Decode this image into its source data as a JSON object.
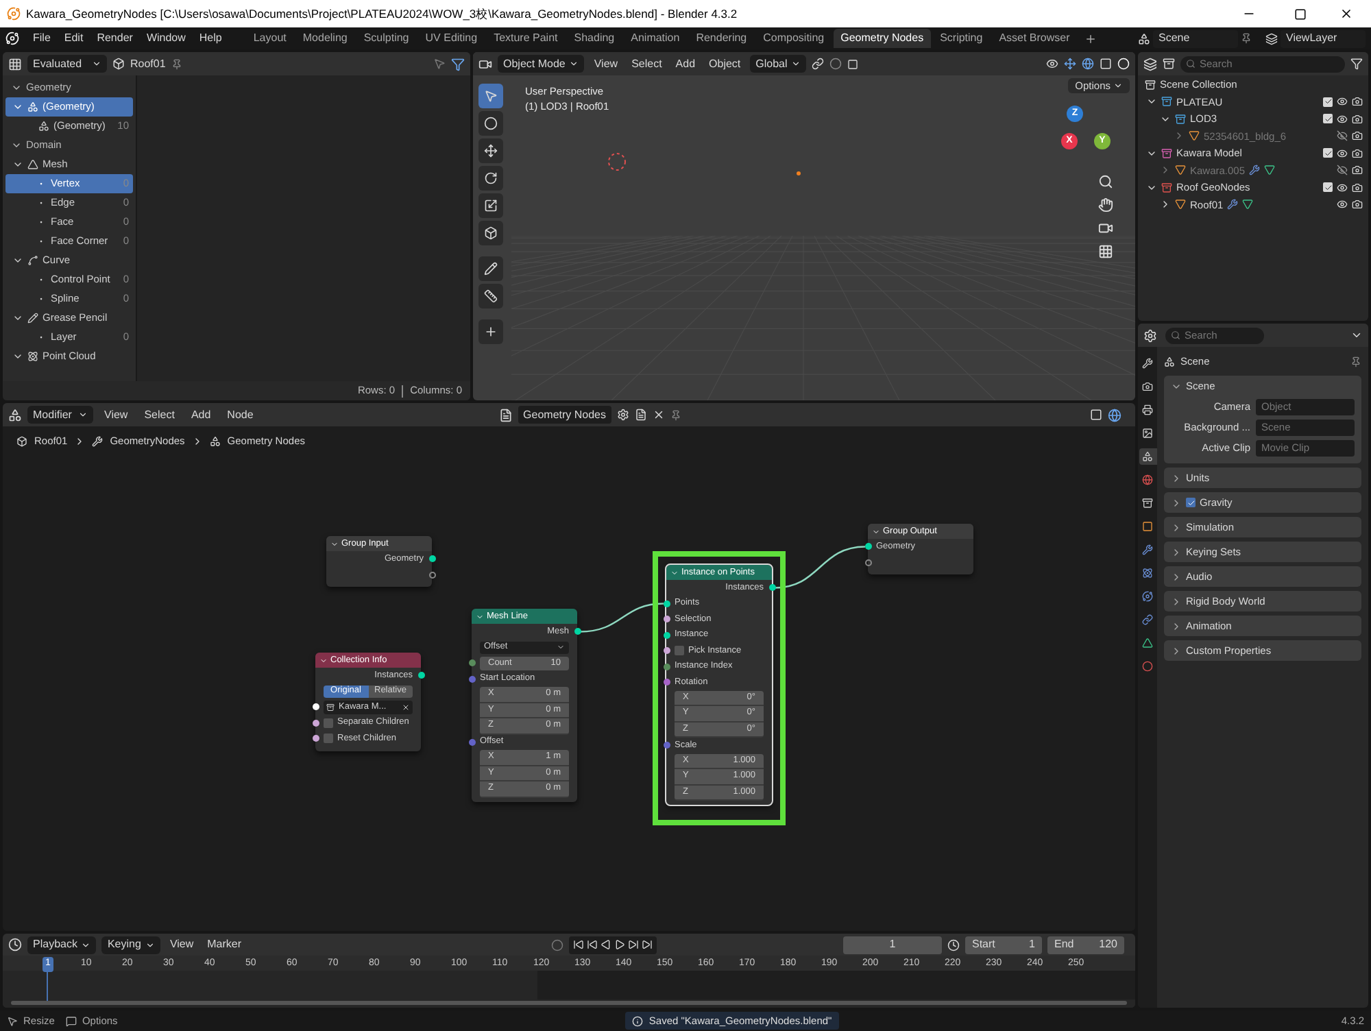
{
  "window": {
    "title": "Kawara_GeometryNodes [C:\\Users\\osawa\\Documents\\Project\\PLATEAU2024\\WOW_3校\\Kawara_GeometryNodes.blend] - Blender 4.3.2"
  },
  "menu": [
    "File",
    "Edit",
    "Render",
    "Window",
    "Help"
  ],
  "workspaces": [
    {
      "label": "Layout",
      "selected": false
    },
    {
      "label": "Modeling",
      "selected": false
    },
    {
      "label": "Sculpting",
      "selected": false
    },
    {
      "label": "UV Editing",
      "selected": false
    },
    {
      "label": "Texture Paint",
      "selected": false
    },
    {
      "label": "Shading",
      "selected": false
    },
    {
      "label": "Animation",
      "selected": false
    },
    {
      "label": "Rendering",
      "selected": false
    },
    {
      "label": "Compositing",
      "selected": false
    },
    {
      "label": "Geometry Nodes",
      "selected": true
    },
    {
      "label": "Scripting",
      "selected": false
    },
    {
      "label": "Asset Browser",
      "selected": false
    }
  ],
  "scene": "Scene",
  "view_layer": "ViewLayer",
  "spreadsheet": {
    "mode": "Evaluated",
    "object": "Roof01",
    "geometry_label": "Geometry",
    "geometry": [
      {
        "label": "(Geometry)",
        "selected": true,
        "expanded": true,
        "children": [
          {
            "label": "(Geometry)",
            "count": "10",
            "selected": false
          }
        ]
      }
    ],
    "domain_label": "Domain",
    "domains": [
      {
        "label": "Mesh",
        "expanded": true,
        "children": [
          {
            "label": "Vertex",
            "count": "0",
            "selected": true
          },
          {
            "label": "Edge",
            "count": "0",
            "selected": false
          },
          {
            "label": "Face",
            "count": "0",
            "selected": false
          },
          {
            "label": "Face Corner",
            "count": "0",
            "selected": false
          }
        ]
      },
      {
        "label": "Curve",
        "expanded": true,
        "children": [
          {
            "label": "Control Point",
            "count": "0",
            "selected": false
          },
          {
            "label": "Spline",
            "count": "0",
            "selected": false
          }
        ]
      },
      {
        "label": "Grease Pencil",
        "expanded": true,
        "children": [
          {
            "label": "Layer",
            "count": "0",
            "selected": false
          }
        ]
      },
      {
        "label": "Point Cloud",
        "expanded": true
      }
    ],
    "rows": "Rows: 0",
    "columns": "Columns: 0"
  },
  "viewport": {
    "mode": "Object Mode",
    "menus": [
      "View",
      "Select",
      "Add",
      "Object"
    ],
    "orientation": "Global",
    "options": "Options",
    "view_name": "User Perspective",
    "view_info": "(1) LOD3 | Roof01",
    "gizmo_axes": [
      "Z",
      "X",
      "Y"
    ],
    "tools": [
      {
        "selected": true
      },
      {
        "selected": false
      },
      {
        "selected": false
      },
      {
        "selected": false
      },
      {
        "selected": false
      },
      {
        "selected": false
      },
      {
        "selected": false
      },
      {
        "selected": false
      },
      {
        "selected": false
      }
    ]
  },
  "outliner": {
    "search_placeholder": "Search",
    "root": "Scene Collection",
    "items": [
      {
        "kind": "collection",
        "label": "PLATEAU",
        "color": "#4aa3df",
        "expanded": true,
        "enabled": true,
        "visible": true,
        "children": [
          {
            "kind": "collection",
            "label": "LOD3",
            "color": "#4aa3df",
            "expanded": true,
            "enabled": true,
            "visible": true,
            "children": [
              {
                "kind": "object",
                "label": "52354601_bldg_6",
                "expanded": false,
                "visible": false,
                "modifiers": false
              }
            ]
          }
        ]
      },
      {
        "kind": "collection",
        "label": "Kawara Model",
        "color": "#d65fb0",
        "expanded": true,
        "enabled": true,
        "visible": true,
        "children": [
          {
            "kind": "object",
            "label": "Kawara.005",
            "expanded": false,
            "visible": false,
            "modifiers": true
          }
        ]
      },
      {
        "kind": "collection",
        "label": "Roof GeoNodes",
        "color": "#e0524e",
        "expanded": true,
        "enabled": true,
        "visible": true,
        "children": [
          {
            "kind": "object",
            "label": "Roof01",
            "expanded": false,
            "visible": true,
            "modifiers": true
          }
        ]
      }
    ]
  },
  "properties": {
    "search_placeholder": "Search",
    "title": "Scene",
    "tabs": [
      {
        "selected": false
      },
      {
        "selected": false
      },
      {
        "selected": false
      },
      {
        "selected": false
      },
      {
        "selected": true
      },
      {
        "selected": false
      },
      {
        "selected": false
      },
      {
        "selected": false
      },
      {
        "selected": false
      },
      {
        "selected": false
      },
      {
        "selected": false
      },
      {
        "selected": false
      },
      {
        "selected": false
      },
      {
        "selected": false
      }
    ],
    "panel": {
      "title": "Scene",
      "expanded": true,
      "fields": [
        {
          "label": "Camera",
          "placeholder": "Object"
        },
        {
          "label": "Background ...",
          "placeholder": "Scene"
        },
        {
          "label": "Active Clip",
          "placeholder": "Movie Clip"
        }
      ]
    },
    "sections": [
      {
        "kind": "plain",
        "label": "Units",
        "expanded": false
      },
      {
        "kind": "checkbox",
        "label": "Gravity",
        "expanded": false,
        "checked": true
      },
      {
        "kind": "plain",
        "label": "Simulation",
        "expanded": false
      },
      {
        "kind": "plain",
        "label": "Keying Sets",
        "expanded": false
      },
      {
        "kind": "plain",
        "label": "Audio",
        "expanded": false
      },
      {
        "kind": "plain",
        "label": "Rigid Body World",
        "expanded": false
      },
      {
        "kind": "plain",
        "label": "Animation",
        "expanded": false
      },
      {
        "kind": "plain",
        "label": "Custom Properties",
        "expanded": false
      }
    ]
  },
  "node_editor": {
    "context": "Modifier",
    "menus": [
      "View",
      "Select",
      "Add",
      "Node"
    ],
    "group_name": "Geometry Nodes",
    "breadcrumbs": [
      "Roof01",
      "GeometryNodes",
      "Geometry Nodes"
    ],
    "nodes": [
      {
        "title": "Group Input",
        "color": "#3c3c3c",
        "highlighted": false,
        "rows": [
          {
            "kind": "output",
            "label": "Geometry",
            "color": "#00d6a3"
          },
          {
            "kind": "empty_out"
          }
        ]
      },
      {
        "title": "Collection Info",
        "color": "#83314a",
        "highlighted": false,
        "rows": [
          {
            "kind": "output",
            "label": "Instances",
            "color": "#00d6a3"
          },
          {
            "kind": "toggle",
            "options": [
              {
                "label": "Original",
                "selected": true
              },
              {
                "label": "Relative",
                "selected": false
              }
            ]
          },
          {
            "kind": "object",
            "value": "Kawara M...",
            "color": "#ffffff"
          },
          {
            "kind": "checkbox",
            "label": "Separate Children",
            "checked": false,
            "color": "#cca6d6"
          },
          {
            "kind": "checkbox",
            "label": "Reset Children",
            "checked": false,
            "color": "#cca6d6"
          }
        ]
      },
      {
        "title": "Mesh Line",
        "color": "#1d725e",
        "highlighted": false,
        "rows": [
          {
            "kind": "output",
            "label": "Mesh",
            "color": "#00d6a3"
          },
          {
            "kind": "dropdown",
            "value": "Offset"
          },
          {
            "kind": "field",
            "label": "Count",
            "value": "10",
            "color": "#598c5c"
          },
          {
            "kind": "vector",
            "label": "Start Location",
            "color": "#6363c7",
            "axes": [
              {
                "axis": "X",
                "value": "0 m"
              },
              {
                "axis": "Y",
                "value": "0 m"
              },
              {
                "axis": "Z",
                "value": "0 m"
              }
            ]
          },
          {
            "kind": "vector",
            "label": "Offset",
            "color": "#6363c7",
            "axes": [
              {
                "axis": "X",
                "value": "1 m"
              },
              {
                "axis": "Y",
                "value": "0 m"
              },
              {
                "axis": "Z",
                "value": "0 m"
              }
            ]
          }
        ]
      },
      {
        "title": "Instance on Points",
        "color": "#1d725e",
        "highlighted": true,
        "rows": [
          {
            "kind": "output",
            "label": "Instances",
            "color": "#00d6a3"
          },
          {
            "kind": "input",
            "label": "Points",
            "color": "#00d6a3"
          },
          {
            "kind": "input",
            "label": "Selection",
            "color": "#cca6d6"
          },
          {
            "kind": "input",
            "label": "Instance",
            "color": "#00d6a3"
          },
          {
            "kind": "checkbox",
            "label": "Pick Instance",
            "checked": false,
            "color": "#cca6d6"
          },
          {
            "kind": "input",
            "label": "Instance Index",
            "color": "#598c5c"
          },
          {
            "kind": "vector",
            "label": "Rotation",
            "color": "#a663c7",
            "axes": [
              {
                "axis": "X",
                "value": "0°"
              },
              {
                "axis": "Y",
                "value": "0°"
              },
              {
                "axis": "Z",
                "value": "0°"
              }
            ]
          },
          {
            "kind": "vector",
            "label": "Scale",
            "color": "#6363c7",
            "axes": [
              {
                "axis": "X",
                "value": "1.000"
              },
              {
                "axis": "Y",
                "value": "1.000"
              },
              {
                "axis": "Z",
                "value": "1.000"
              }
            ]
          }
        ]
      },
      {
        "title": "Group Output",
        "color": "#3c3c3c",
        "highlighted": false,
        "rows": [
          {
            "kind": "input",
            "label": "Geometry",
            "color": "#00d6a3"
          },
          {
            "kind": "empty_in"
          }
        ]
      }
    ]
  },
  "timeline": {
    "menus": [
      "Playback",
      "Keying",
      "View",
      "Marker"
    ],
    "current_frame": "1",
    "start_label": "Start",
    "start": "1",
    "end_label": "End",
    "end": "120",
    "ticks": [
      {
        "label": "1",
        "selected": true
      },
      {
        "label": "10",
        "selected": false
      },
      {
        "label": "20",
        "selected": false
      },
      {
        "label": "30",
        "selected": false
      },
      {
        "label": "40",
        "selected": false
      },
      {
        "label": "50",
        "selected": false
      },
      {
        "label": "60",
        "selected": false
      },
      {
        "label": "70",
        "selected": false
      },
      {
        "label": "80",
        "selected": false
      },
      {
        "label": "90",
        "selected": false
      },
      {
        "label": "100",
        "selected": false
      },
      {
        "label": "110",
        "selected": false
      },
      {
        "label": "120",
        "selected": false
      },
      {
        "label": "130",
        "selected": false
      },
      {
        "label": "140",
        "selected": false
      },
      {
        "label": "150",
        "selected": false
      },
      {
        "label": "160",
        "selected": false
      },
      {
        "label": "170",
        "selected": false
      },
      {
        "label": "180",
        "selected": false
      },
      {
        "label": "190",
        "selected": false
      },
      {
        "label": "200",
        "selected": false
      },
      {
        "label": "210",
        "selected": false
      },
      {
        "label": "220",
        "selected": false
      },
      {
        "label": "230",
        "selected": false
      },
      {
        "label": "240",
        "selected": false
      },
      {
        "label": "250",
        "selected": false
      }
    ]
  },
  "status_bar": {
    "items": [
      "Resize",
      "Options"
    ],
    "message": "Saved \"Kawara_GeometryNodes.blend\"",
    "version": "4.3.2"
  }
}
